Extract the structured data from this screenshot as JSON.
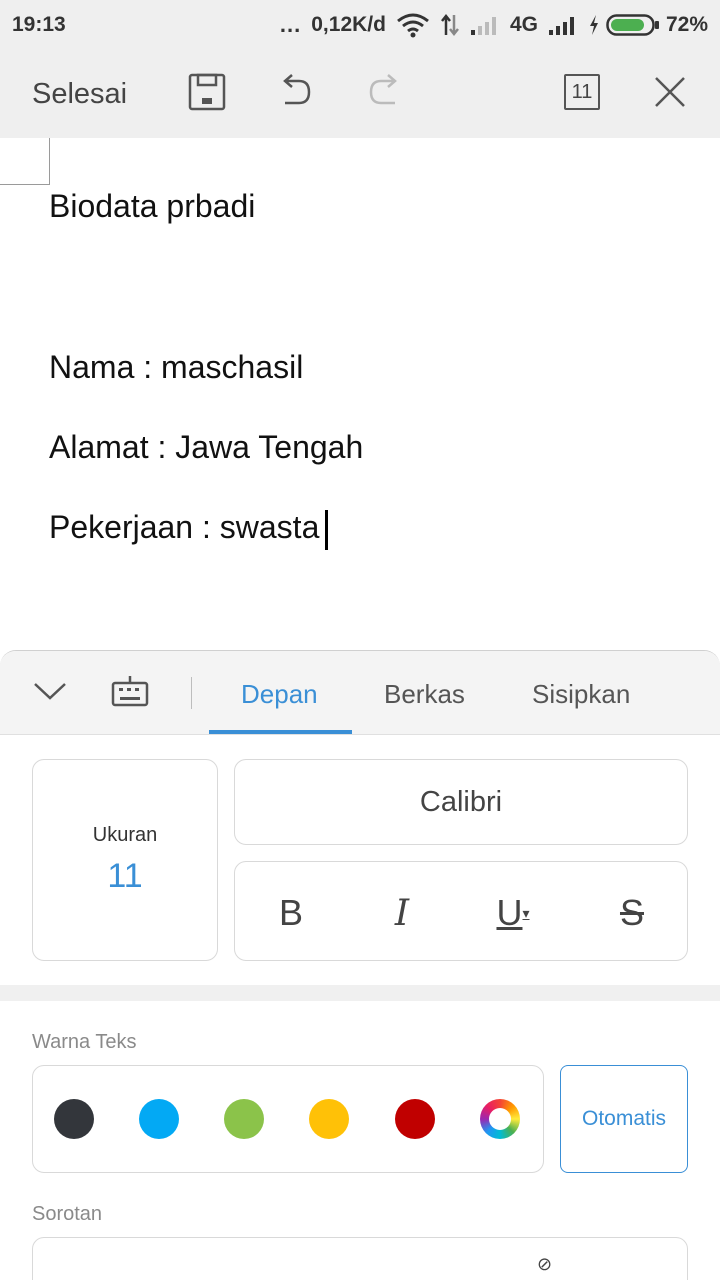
{
  "status_bar": {
    "time": "19:13",
    "dots": "...",
    "network_speed": "0,12K/d",
    "network_type": "4G",
    "battery": "72%",
    "icons": [
      "wifi-icon",
      "data-arrows-icon",
      "signal-weak-icon",
      "signal-strong-icon",
      "charging-icon",
      "battery-icon"
    ]
  },
  "toolbar": {
    "done_label": "Selesai",
    "page_size": "11",
    "icons": [
      "save-icon",
      "undo-icon",
      "redo-icon",
      "page-icon",
      "close-icon"
    ]
  },
  "document": {
    "lines": [
      "Biodata prbadi",
      "Nama : maschasil",
      "Alamat : Jawa Tengah",
      "Pekerjaan : swasta"
    ]
  },
  "panel": {
    "tabs": [
      "Depan",
      "Berkas",
      "Sisipkan"
    ],
    "active_tab": "Depan",
    "size_label": "Ukuran",
    "size_value": "11",
    "font_name": "Calibri",
    "styles": {
      "bold": "B",
      "italic": "I",
      "underline": "U",
      "strike": "S"
    },
    "text_color_label": "Warna Teks",
    "colors": [
      "#33363b",
      "#03a9f4",
      "#8bc34a",
      "#ffc107",
      "#c00000"
    ],
    "auto_label": "Otomatis",
    "highlight_label": "Sorotan",
    "accent_color": "#3a8fd6"
  }
}
